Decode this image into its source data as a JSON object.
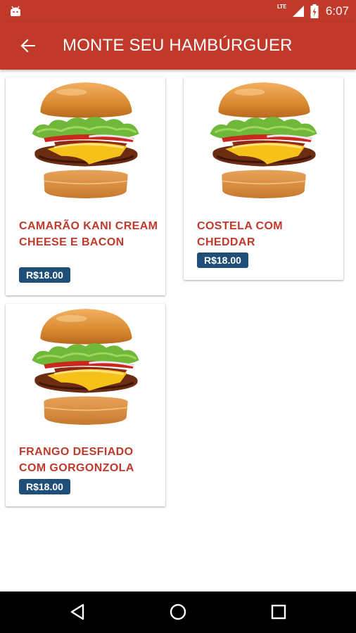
{
  "status_bar": {
    "network": "LTE",
    "time": "6:07"
  },
  "app_bar": {
    "title": "MONTE SEU HAMBÚRGUER",
    "back_icon": "arrow-left-icon"
  },
  "colors": {
    "primary": "#c0392b",
    "price_badge": "#1f4e79",
    "navbar": "#000000"
  },
  "products": [
    {
      "name": "CAMARÃO KANI CREAM CHEESE E BACON",
      "price": "R$18.00"
    },
    {
      "name": "COSTELA COM CHEDDAR",
      "price": "R$18.00"
    },
    {
      "name": "FRANGO DESFIADO COM GORGONZOLA",
      "price": "R$18.00"
    }
  ],
  "nav": {
    "back": "triangle-back-icon",
    "home": "circle-home-icon",
    "recents": "square-recents-icon"
  }
}
